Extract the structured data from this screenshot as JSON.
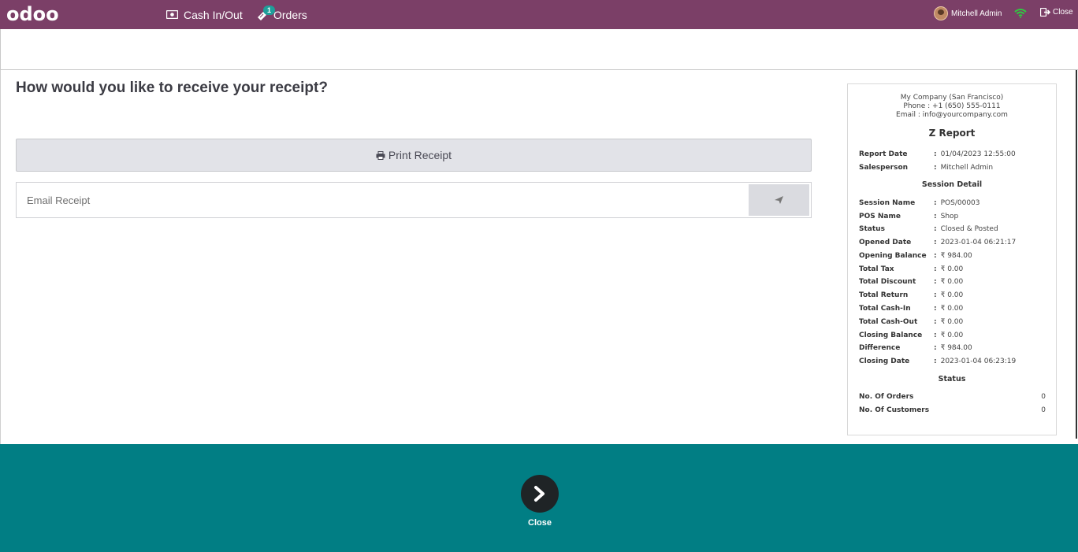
{
  "topbar": {
    "logo": "odoo",
    "cash_label": "Cash In/Out",
    "orders_label": "Orders",
    "orders_badge": "1",
    "user_name": "Mitchell Admin",
    "close_label": "Close",
    "bg_color": "#7b3f67",
    "wifi_color": "#2ecc40"
  },
  "main": {
    "question": "How would you like to receive your receipt?",
    "print_label": "Print Receipt",
    "email_placeholder": "Email Receipt"
  },
  "receipt": {
    "company": "My Company (San Francisco)",
    "phone": "Phone : +1 (650) 555-0111",
    "email": "Email : info@yourcompany.com",
    "title": "Z Report",
    "header_rows": [
      {
        "label": "Report Date",
        "value": "01/04/2023 12:55:00"
      },
      {
        "label": "Salesperson",
        "value": "Mitchell Admin"
      }
    ],
    "session_title": "Session Detail",
    "session_rows": [
      {
        "label": "Session Name",
        "value": "POS/00003"
      },
      {
        "label": "POS Name",
        "value": "Shop"
      },
      {
        "label": "Status",
        "value": "Closed & Posted"
      },
      {
        "label": "Opened Date",
        "value": "2023-01-04 06:21:17"
      },
      {
        "label": "Opening Balance",
        "value": "₹ 984.00"
      },
      {
        "label": "Total Tax",
        "value": "₹ 0.00"
      },
      {
        "label": "Total Discount",
        "value": "₹ 0.00"
      },
      {
        "label": "Total Return",
        "value": "₹ 0.00"
      },
      {
        "label": "Total Cash-In",
        "value": "₹ 0.00"
      },
      {
        "label": "Total Cash-Out",
        "value": "₹ 0.00"
      },
      {
        "label": "Closing Balance",
        "value": "₹ 0.00"
      },
      {
        "label": "Difference",
        "value": "₹ 984.00"
      },
      {
        "label": "Closing Date",
        "value": "2023-01-04 06:23:19"
      }
    ],
    "status_title": "Status",
    "status_rows": [
      {
        "label": "No. Of Orders",
        "value": "0"
      },
      {
        "label": "No. Of Customers",
        "value": "0"
      }
    ]
  },
  "footer": {
    "close_label": "Close",
    "bg_color": "#017e84"
  }
}
